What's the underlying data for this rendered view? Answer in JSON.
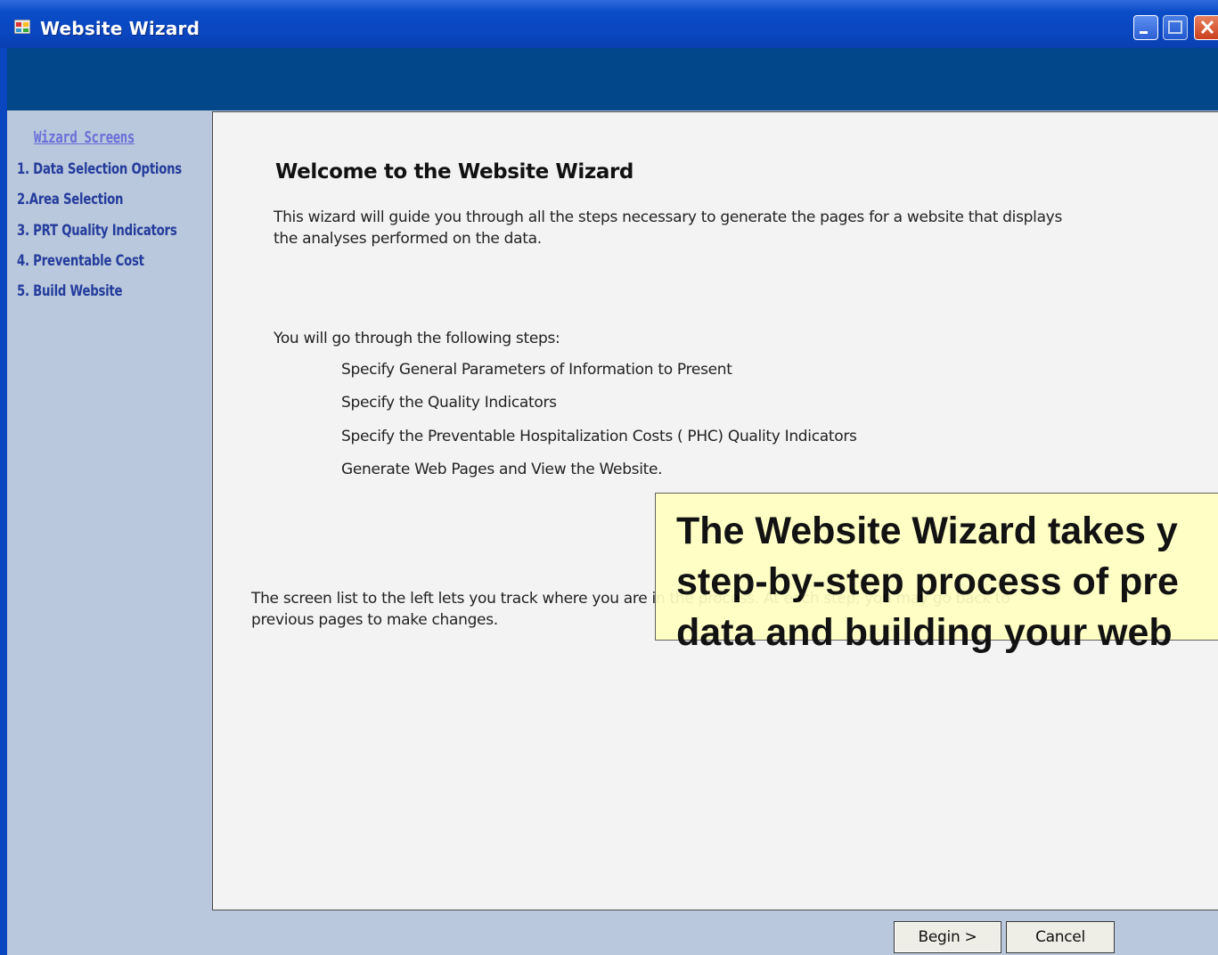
{
  "window": {
    "title": "Website Wizard",
    "icon": "app-window-icon"
  },
  "sidebar": {
    "heading": "Wizard Screens",
    "items": [
      {
        "label": "1. Data Selection Options"
      },
      {
        "label": "2.Area Selection"
      },
      {
        "label": "3. PRT Quality Indicators"
      },
      {
        "label": "4. Preventable Cost"
      },
      {
        "label": "5. Build Website"
      }
    ]
  },
  "main": {
    "heading": "Welcome to the Website Wizard",
    "intro_line1": "This wizard will guide you through all the steps necessary to generate the pages for a website that displays",
    "intro_line2": "the analyses performed on the data.",
    "steps_intro": "You will go through the following steps:",
    "steps": [
      "Specify General Parameters of Information to Present",
      "Specify the  Quality Indicators",
      "Specify the Preventable Hospitalization Costs ( PHC) Quality Indicators",
      "Generate Web Pages and View the Website."
    ],
    "footer_line1": "The screen list to the left lets you track where you are in the process. At each step, you may go back to",
    "footer_line2": "previous pages to make changes."
  },
  "callout": {
    "line1": "The Website Wizard takes y",
    "line2": "step-by-step process of pre",
    "line3": "data and building your web"
  },
  "buttons": {
    "begin": "Begin >",
    "cancel": "Cancel"
  },
  "colors": {
    "titlebar": "#0a46c0",
    "banner": "#02478a",
    "sidebar": "#b9c8dc",
    "callout": "#ffffc2",
    "sidebar_link": "#243c9c"
  }
}
